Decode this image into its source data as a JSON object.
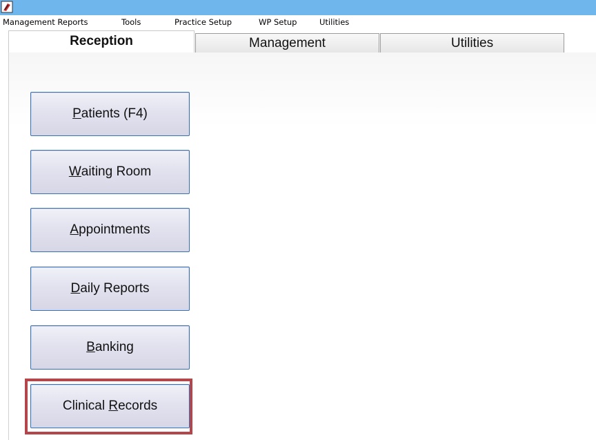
{
  "menubar": {
    "items": [
      "Management Reports",
      "Tools",
      "Practice Setup",
      "WP Setup",
      "Utilities"
    ]
  },
  "tabs": [
    {
      "label": "Reception",
      "active": true
    },
    {
      "label": "Management",
      "active": false
    },
    {
      "label": "Utilities",
      "active": false
    }
  ],
  "buttons": [
    {
      "pre": "",
      "key": "P",
      "post": "atients (F4)"
    },
    {
      "pre": "",
      "key": "W",
      "post": "aiting Room"
    },
    {
      "pre": "",
      "key": "A",
      "post": "ppointments"
    },
    {
      "pre": "",
      "key": "D",
      "post": "aily Reports"
    },
    {
      "pre": "",
      "key": "B",
      "post": "anking"
    },
    {
      "pre": "Clinical ",
      "key": "R",
      "post": "ecords"
    }
  ],
  "colors": {
    "titlebar": "#6fb6ec",
    "highlight": "#b3454b",
    "button_border": "#3a6fb0"
  }
}
